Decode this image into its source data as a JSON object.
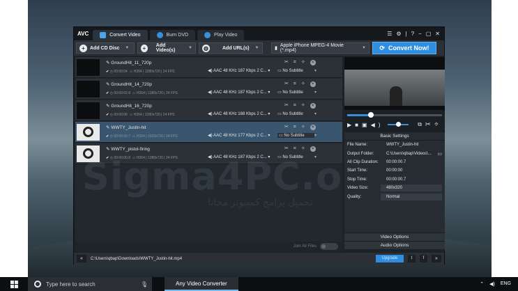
{
  "app": {
    "logo": "AVC",
    "tabs": [
      {
        "label": "Convert Video"
      },
      {
        "label": "Burn DVD"
      },
      {
        "label": "Play Video"
      }
    ]
  },
  "toolbar": {
    "add_cd": "Add CD Disc",
    "add_videos": "Add Video(s)",
    "add_urls": "Add URL(s)",
    "profile": "Apple iPhone MPEG-4 Movie (*.mp4)",
    "convert": "Convert Now!"
  },
  "files": [
    {
      "name": "GroundHit_11_720p",
      "duration": "00:00:04",
      "video": "H264 | 1280x720 | 24 FPS",
      "audio": "AAC 48 KHz 187 Kbps 2 C...",
      "subtitle": "No Subtitle"
    },
    {
      "name": "GroundHit_14_720p",
      "duration": "00:00:02.8",
      "video": "H264 | 1280x720 | 24 FPS",
      "audio": "AAC 48 KHz 187 Kbps 2 C...",
      "subtitle": "No Subtitle"
    },
    {
      "name": "GroundHit_16_720p",
      "duration": "00:00:06",
      "video": "H264 | 1280x720 | 24 FPS",
      "audio": "AAC 48 KHz 188 Kbps 2 C...",
      "subtitle": "No Subtitle"
    },
    {
      "name": "WWTY_Justin-hit",
      "duration": "00:00:00.7",
      "video": "H264 | 1920x720 | 24 FPS",
      "audio": "AAC 48 KHz 177 Kbps 2 C...",
      "subtitle": "No Subtitle"
    },
    {
      "name": "WWTY_pistol-firing",
      "duration": "00:00:00.8",
      "video": "H264 | 1280x720 | 24 FPS",
      "audio": "AAC 48 KHz 187 Kbps 2 C...",
      "subtitle": "No Subtitle"
    }
  ],
  "watermark": {
    "main": "Sigma4PC.org",
    "sub": "تحميل برامج كمبيوتر مجانا"
  },
  "join": "Join All Files",
  "settings": {
    "title": "Basic Settings",
    "rows": [
      {
        "label": "File Name:",
        "value": "WWTY_Justin-hit"
      },
      {
        "label": "Output Folder:",
        "value": "C:\\Users\\qbap\\Videos\\..."
      },
      {
        "label": "All Clip Duration:",
        "value": "00:00:00.7"
      },
      {
        "label": "Start Time:",
        "value": "00:00:00"
      },
      {
        "label": "Stop Time:",
        "value": "00:00:00.7"
      },
      {
        "label": "Video Size:",
        "value": "480x320"
      },
      {
        "label": "Quality:",
        "value": "Normal"
      }
    ],
    "video_options": "Video Options",
    "audio_options": "Audio Options"
  },
  "bottom": {
    "path": "C:\\Users\\qbap\\Downloads\\WWTY_Justin-hit.mp4",
    "upgrade": "Upgrade"
  },
  "taskbar": {
    "search": "Type here to search",
    "task": "Any Video Converter",
    "lang": "ENG"
  }
}
